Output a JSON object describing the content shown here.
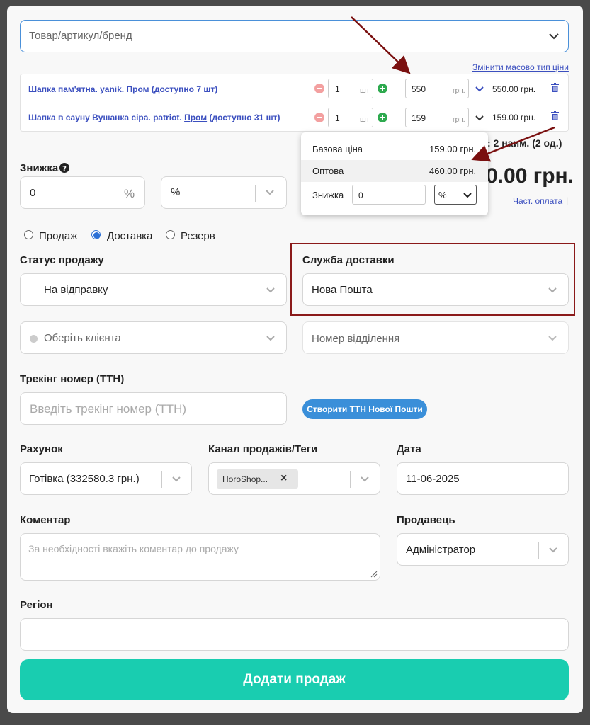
{
  "search": {
    "placeholder": "Товар/артикул/бренд"
  },
  "mass_change_link": "Змінити масово тип ціни",
  "products": [
    {
      "name": "Шапка пам'ятна. yanik.",
      "source": "Пром",
      "availability": "(доступно 7 шт)",
      "qty": "1",
      "unit": "шт",
      "price": "550",
      "currency": "грн.",
      "total": "550.00 грн."
    },
    {
      "name": "Шапка в сауну Вушанка сіра. patriot.",
      "source": "Пром",
      "availability": "(доступно 31 шт)",
      "qty": "1",
      "unit": "шт",
      "price": "159",
      "currency": "грн.",
      "total": "159.00 грн."
    }
  ],
  "price_popup": {
    "rows": [
      {
        "label": "Базова ціна",
        "value": "159.00 грн."
      },
      {
        "label": "Оптова",
        "value": "460.00 грн."
      }
    ],
    "discount_label": "Знижка",
    "discount_value": "0",
    "discount_type": "%"
  },
  "summary": {
    "count": ": 2 наим. (2 од.)",
    "total": "0.00 грн.",
    "partial_payment": "Част. оплата",
    "partial_separator": "|"
  },
  "discount": {
    "label": "Знижка",
    "value": "0",
    "unit": "%",
    "type": "%"
  },
  "mode": {
    "options": [
      "Продаж",
      "Доставка",
      "Резерв"
    ],
    "selected": 1
  },
  "sale_status": {
    "label": "Статус продажу",
    "value": "На відправку"
  },
  "delivery_service": {
    "label": "Служба доставки",
    "value": "Нова Пошта"
  },
  "client": {
    "placeholder": "Оберіть клієнта"
  },
  "branch": {
    "placeholder": "Номер відділення"
  },
  "tracking": {
    "label": "Трекінг номер (ТТН)",
    "placeholder": "Введіть трекінг номер (ТТН)",
    "create_button": "Створити ТТН Нової Пошти"
  },
  "account": {
    "label": "Рахунок",
    "value": "Готівка (332580.3 грн.)"
  },
  "channel": {
    "label": "Канал продажів/Теги",
    "tag": "HoroShop...",
    "tag_remove": "×"
  },
  "date": {
    "label": "Дата",
    "value": "11-06-2025"
  },
  "comment": {
    "label": "Коментар",
    "placeholder": "За необхідності вкажіть коментар до продажу"
  },
  "seller": {
    "label": "Продавець",
    "value": "Адміністратор"
  },
  "region": {
    "label": "Регіон",
    "value": ""
  },
  "submit": {
    "label": "Додати продаж"
  },
  "colors": {
    "accent": "#19cdb0",
    "link": "#3b4fbf",
    "highlight_box": "#8b1a1a",
    "arrow": "#7a1010",
    "primary_blue": "#3a8fd9"
  }
}
